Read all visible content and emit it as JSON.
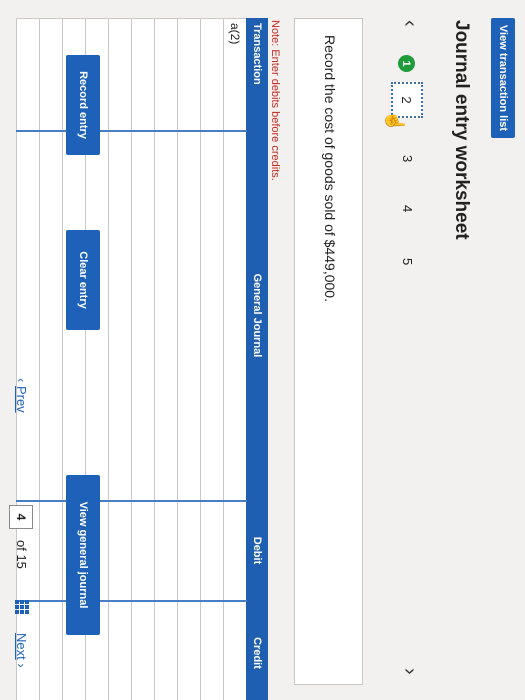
{
  "toolbar": {
    "view_transaction_list": "View transaction list"
  },
  "worksheet": {
    "title": "Journal entry worksheet"
  },
  "steps": [
    "1",
    "2",
    "3",
    "4",
    "5"
  ],
  "current_step": "1",
  "prompt": "Record the cost of goods sold of $449,000.",
  "note": "Note: Enter debits before credits.",
  "table": {
    "headers": [
      "Transaction",
      "General Journal",
      "Debit",
      "Credit"
    ],
    "rows": [
      [
        "a(2)",
        "",
        "",
        ""
      ],
      [
        "",
        "",
        "",
        ""
      ],
      [
        "",
        "",
        "",
        ""
      ],
      [
        "",
        "",
        "",
        ""
      ],
      [
        "",
        "",
        "",
        ""
      ],
      [
        "",
        "",
        "",
        ""
      ],
      [
        "",
        "",
        "",
        ""
      ],
      [
        "",
        "",
        "",
        ""
      ],
      [
        "",
        "",
        "",
        ""
      ],
      [
        "",
        "",
        "",
        ""
      ]
    ]
  },
  "buttons": {
    "record_entry": "Record entry",
    "clear_entry": "Clear entry",
    "view_general_journal": "View general journal"
  },
  "pager": {
    "prev": "Prev",
    "current": "4",
    "of_text": "of 15",
    "next": "Next"
  },
  "icons": {
    "prev_step": "chevron-left-icon",
    "next_step": "chevron-right-icon",
    "pointer": "hand-pointer-icon",
    "page_grid": "grid-icon"
  },
  "colors": {
    "primary_blue": "#1d62b8",
    "step_green": "#1f9b3a",
    "note_red": "#c42b22"
  }
}
